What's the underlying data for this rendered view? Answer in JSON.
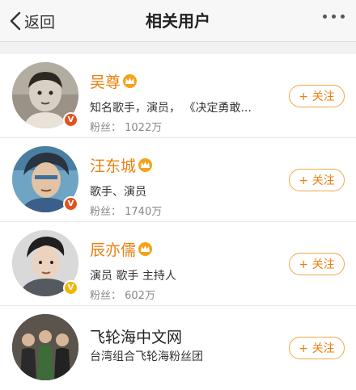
{
  "nav": {
    "back_label": "返回",
    "title": "相关用户"
  },
  "colors": {
    "accent": "#ea8010",
    "follow_border": "#f0a847",
    "verified_red": "#e0531e",
    "verified_gold": "#f5b400"
  },
  "users": [
    {
      "name": "吴尊",
      "desc": "知名歌手，演员， 《决定勇敢...",
      "fans": "粉丝： 1022万",
      "follow_label": "+ 关注",
      "verified": "red",
      "vip": true
    },
    {
      "name": "汪东城",
      "desc": "歌手、演员",
      "fans": "粉丝： 1740万",
      "follow_label": "+ 关注",
      "verified": "red",
      "vip": true
    },
    {
      "name": "辰亦儒",
      "desc": "演员 歌手 主持人",
      "fans": "粉丝： 602万",
      "follow_label": "+ 关注",
      "verified": "gold",
      "vip": true
    },
    {
      "name": "飞轮海中文网",
      "desc": "台湾组合飞轮海粉丝团",
      "fans": "",
      "follow_label": "+ 关注",
      "verified": "none",
      "vip": false
    }
  ],
  "icons": [
    "chevron-left-icon",
    "more-dots-icon",
    "verified-badge-icon",
    "vip-crown-icon"
  ]
}
